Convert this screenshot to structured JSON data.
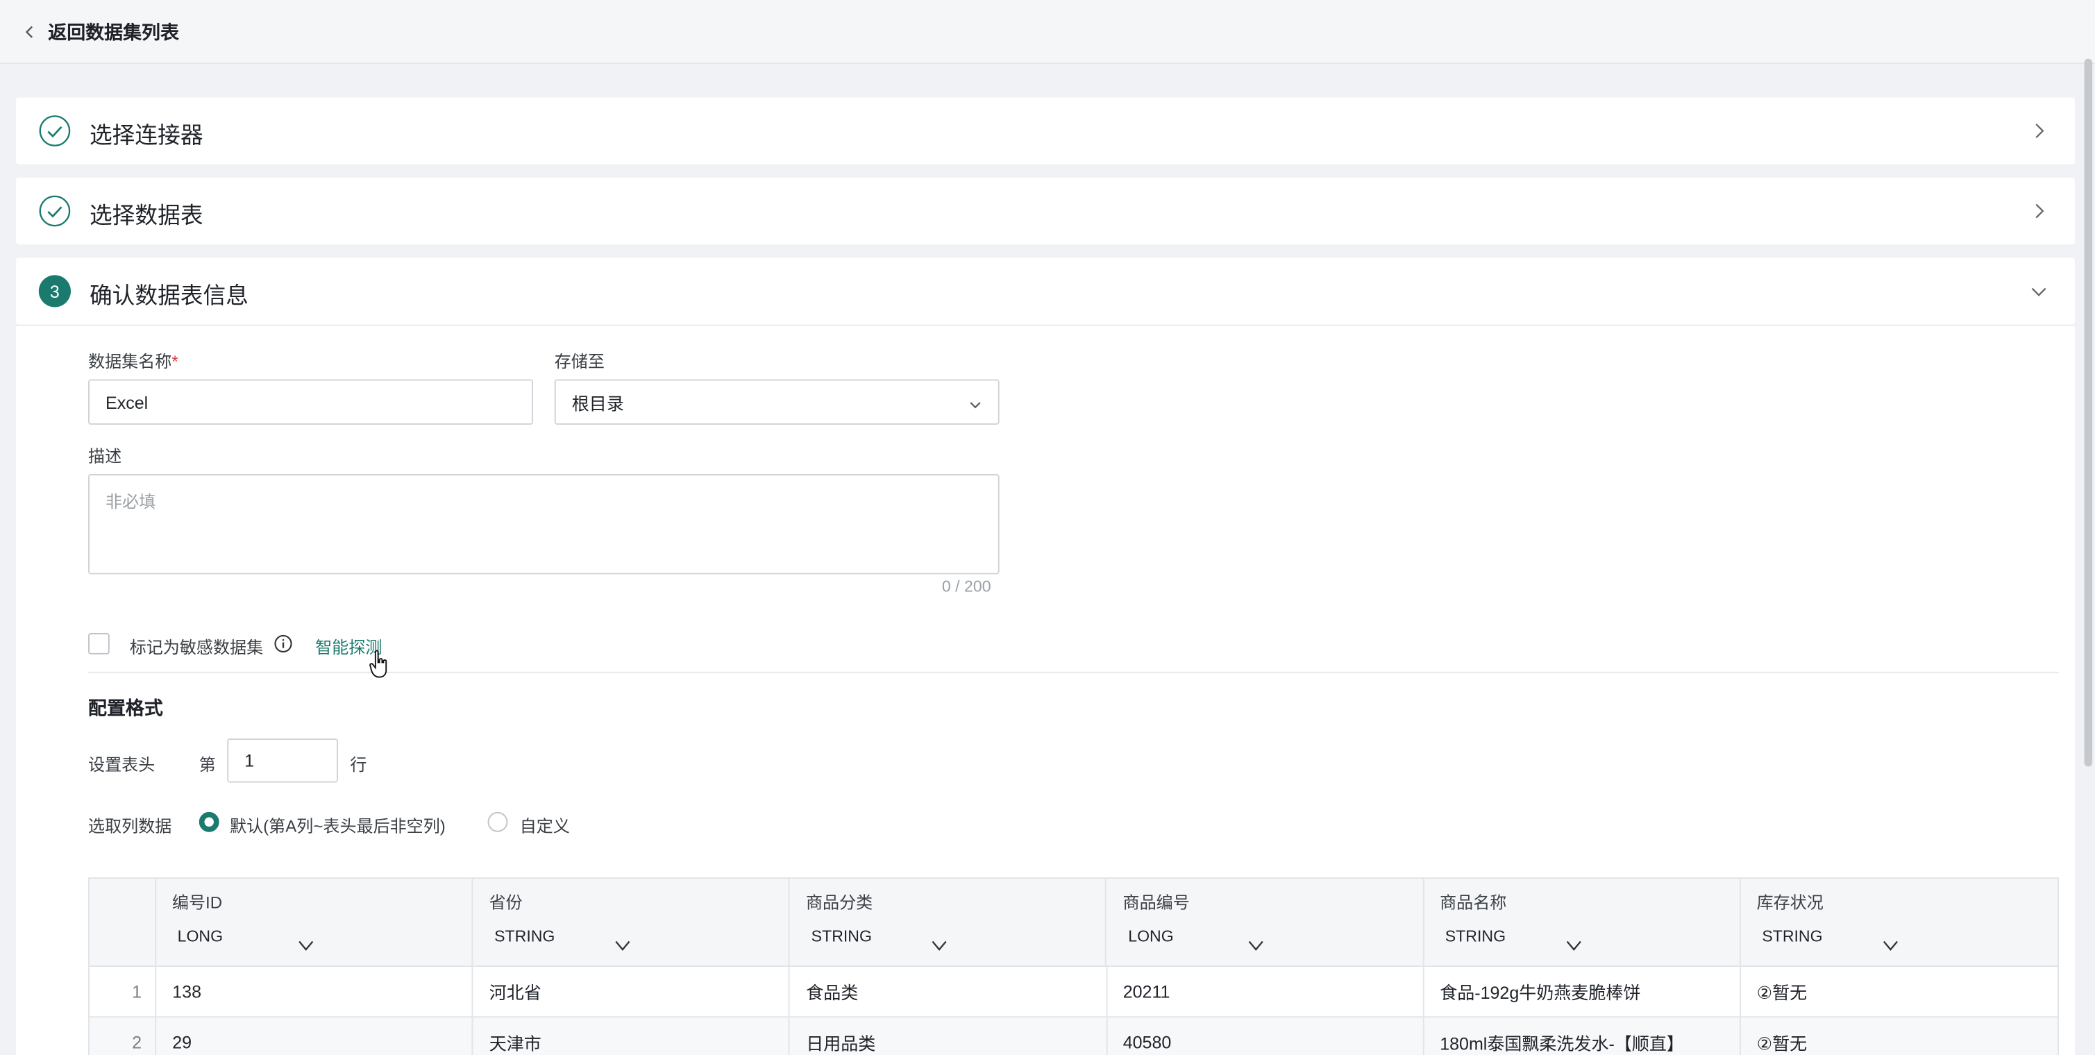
{
  "topbar": {
    "back_label": "返回数据集列表"
  },
  "steps": [
    {
      "title": "选择连接器",
      "state": "done"
    },
    {
      "title": "选择数据表",
      "state": "done"
    },
    {
      "title": "确认数据表信息",
      "state": "active",
      "number": "3"
    }
  ],
  "form": {
    "name_label": "数据集名称",
    "name_required_mark": "*",
    "name_value": "Excel",
    "store_label": "存储至",
    "store_value": "根目录",
    "desc_label": "描述",
    "desc_placeholder": "非必填",
    "desc_counter": "0 / 200",
    "sensitive_label": "标记为敏感数据集",
    "smart_detect": "智能探测"
  },
  "format": {
    "section_title": "配置格式",
    "header_label": "设置表头",
    "header_prefix": "第",
    "header_value": "1",
    "header_suffix": "行",
    "columns_label": "选取列数据",
    "option_default": "默认(第A列~表头最后非空列)",
    "option_custom": "自定义",
    "selected": "default"
  },
  "table": {
    "columns": [
      {
        "name": "编号ID",
        "type": "LONG"
      },
      {
        "name": "省份",
        "type": "STRING"
      },
      {
        "name": "商品分类",
        "type": "STRING"
      },
      {
        "name": "商品编号",
        "type": "LONG"
      },
      {
        "name": "商品名称",
        "type": "STRING"
      },
      {
        "name": "库存状况",
        "type": "STRING"
      }
    ],
    "rows": [
      {
        "idx": "1",
        "cells": [
          "138",
          "河北省",
          "食品类",
          "20211",
          "食品-192g牛奶燕麦脆棒饼",
          "②暂无"
        ]
      },
      {
        "idx": "2",
        "cells": [
          "29",
          "天津市",
          "日用品类",
          "40580",
          "180ml泰国飘柔洗发水-【顺直】",
          "②暂无"
        ]
      }
    ]
  },
  "colors": {
    "accent": "#1b7a6e",
    "required": "#e0393e"
  }
}
